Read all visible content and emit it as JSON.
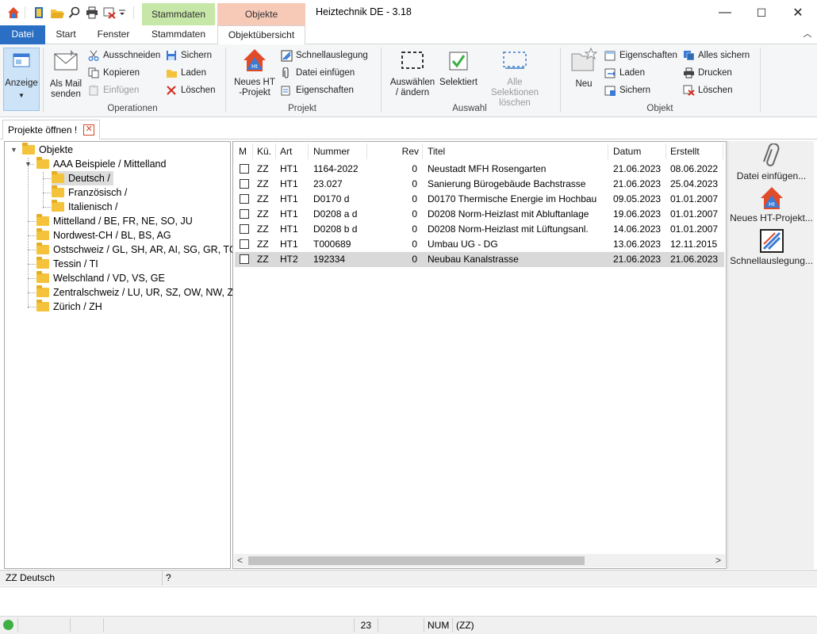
{
  "titlebar": {
    "app_title": "Heiztechnik DE - 3.18",
    "context_tab_stammdaten": "Stammdaten",
    "context_tab_objekte": "Objekte",
    "context_colors": {
      "stammdaten": "#c6e7a7",
      "objekte": "#f7c9b7"
    },
    "qat_icons": [
      "app-icon",
      "exit-icon",
      "open-folder-icon",
      "search-icon",
      "print-icon",
      "delete-icon",
      "dropdown-icon"
    ],
    "window_buttons": {
      "minimize": "—",
      "maximize": "☐",
      "close": "✕"
    }
  },
  "ribbon_tabs": {
    "datei": "Datei",
    "start": "Start",
    "fenster": "Fenster",
    "stammdaten": "Stammdaten",
    "objektuebersicht": "Objektübersicht",
    "collapse": "︿"
  },
  "ribbon": {
    "anzeige": "Anzeige",
    "operationen": {
      "label": "Operationen",
      "mail": "Als Mail senden",
      "ausschneiden": "Ausschneiden",
      "kopieren": "Kopieren",
      "einfuegen": "Einfügen",
      "sichern": "Sichern",
      "laden": "Laden",
      "loeschen": "Löschen"
    },
    "projekt": {
      "label": "Projekt",
      "neues": "Neues HT -Projekt",
      "schnell": "Schnellauslegung",
      "datei": "Datei einfügen",
      "eigenschaften": "Eigenschaften"
    },
    "auswahl": {
      "label": "Auswahl",
      "auswaehlen": "Auswählen / ändern",
      "selektiert": "Selektiert",
      "alle_loeschen": "Alle Selektionen löschen"
    },
    "objekt": {
      "label": "Objekt",
      "neu": "Neu",
      "eigenschaften": "Eigenschaften",
      "laden": "Laden",
      "sichern": "Sichern",
      "alles_sichern": "Alles sichern",
      "drucken": "Drucken",
      "loeschen": "Löschen"
    }
  },
  "doc_tab": {
    "label": "Projekte öffnen !",
    "close": "✕"
  },
  "tree": {
    "root": "Objekte",
    "aaa": "AAA Beispiele / Mittelland",
    "deutsch": "Deutsch /",
    "franz": "Französisch /",
    "ital": "Italienisch /",
    "items": [
      "Mittelland / BE, FR, NE, SO, JU",
      "Nordwest-CH / BL, BS, AG",
      "Ostschweiz / GL, SH, AR, AI, SG, GR, TG",
      "Tessin / TI",
      "Welschland / VD, VS, GE",
      "Zentralschweiz / LU, UR, SZ, OW, NW, ZG",
      "Zürich / ZH"
    ]
  },
  "list": {
    "headers": {
      "m": "M",
      "ku": "Kü.",
      "art": "Art",
      "nummer": "Nummer",
      "rev": "Rev",
      "titel": "Titel",
      "datum": "Datum",
      "erstellt": "Erstellt"
    },
    "rows": [
      {
        "ku": "ZZ",
        "art": "HT1",
        "nummer": "1164-2022",
        "rev": "0",
        "titel": "Neustadt MFH Rosengarten",
        "datum": "21.06.2023",
        "erstellt": "08.06.2022"
      },
      {
        "ku": "ZZ",
        "art": "HT1",
        "nummer": "23.027",
        "rev": "0",
        "titel": "Sanierung Bürogebäude Bachstrasse",
        "datum": "21.06.2023",
        "erstellt": "25.04.2023"
      },
      {
        "ku": "ZZ",
        "art": "HT1",
        "nummer": "D0170 d",
        "rev": "0",
        "titel": "D0170 Thermische Energie im Hochbau",
        "datum": "09.05.2023",
        "erstellt": "01.01.2007"
      },
      {
        "ku": "ZZ",
        "art": "HT1",
        "nummer": "D0208 a d",
        "rev": "0",
        "titel": "D0208 Norm-Heizlast mit Abluftanlage",
        "datum": "19.06.2023",
        "erstellt": "01.01.2007"
      },
      {
        "ku": "ZZ",
        "art": "HT1",
        "nummer": "D0208 b d",
        "rev": "0",
        "titel": "D0208 Norm-Heizlast mit Lüftungsanl.",
        "datum": "14.06.2023",
        "erstellt": "01.01.2007"
      },
      {
        "ku": "ZZ",
        "art": "HT1",
        "nummer": "T000689",
        "rev": "0",
        "titel": "Umbau UG - DG",
        "datum": "13.06.2023",
        "erstellt": "12.11.2015"
      },
      {
        "ku": "ZZ",
        "art": "HT2",
        "nummer": "192334",
        "rev": "0",
        "titel": "Neubau Kanalstrasse",
        "datum": "21.06.2023",
        "erstellt": "21.06.2023"
      }
    ],
    "scroll_left": "<",
    "scroll_right": ">"
  },
  "right_panel": {
    "datei": "Datei einfügen...",
    "neues": "Neues HT-Projekt...",
    "schnell": "Schnellauslegung..."
  },
  "status": {
    "left": "ZZ Deutsch",
    "help": "?",
    "count": "23",
    "num": "NUM",
    "zz": "(ZZ)",
    "indicator_color": "#3cb043"
  }
}
